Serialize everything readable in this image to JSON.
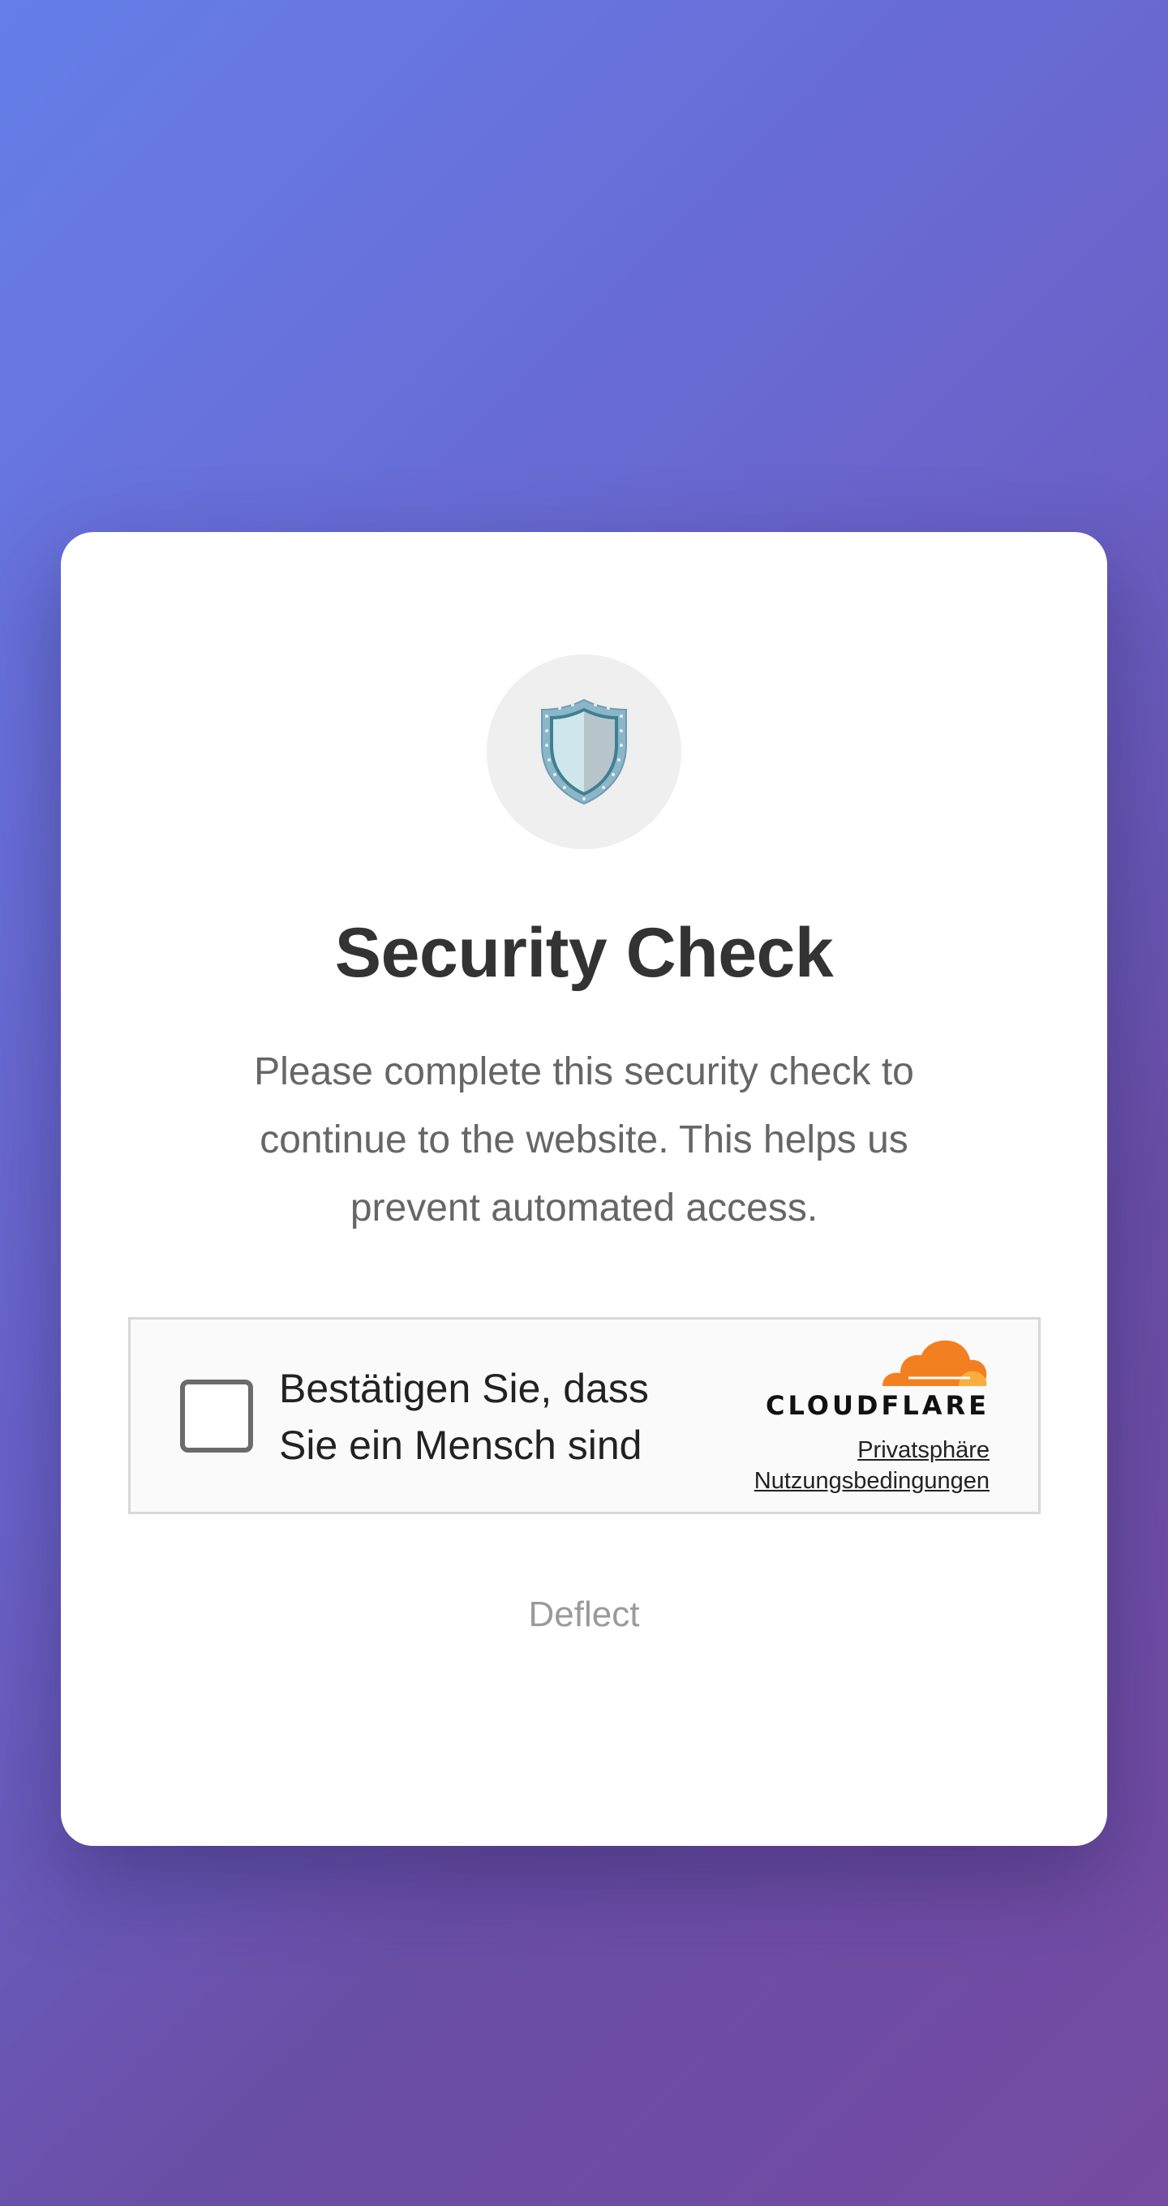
{
  "colors": {
    "background_start": "#667eea",
    "background_end": "#764ba2",
    "card": "#ffffff",
    "title": "#333333",
    "description": "#666666",
    "cloudflare_orange": "#f38020",
    "cloudflare_light_orange": "#faae40"
  },
  "card": {
    "icon": "shield-icon",
    "title": "Security Check",
    "description": "Please complete this security check to continue to the website. This helps us prevent automated access."
  },
  "widget": {
    "checked": false,
    "label": "Bestätigen Sie, dass Sie ein Mensch sind",
    "brand_icon": "cloudflare-cloud-icon",
    "brand_name": "CLOUDFLARE",
    "privacy_link": "Privatsphäre",
    "terms_link": "Nutzungsbedingungen"
  },
  "footer": {
    "label": "Deflect"
  }
}
